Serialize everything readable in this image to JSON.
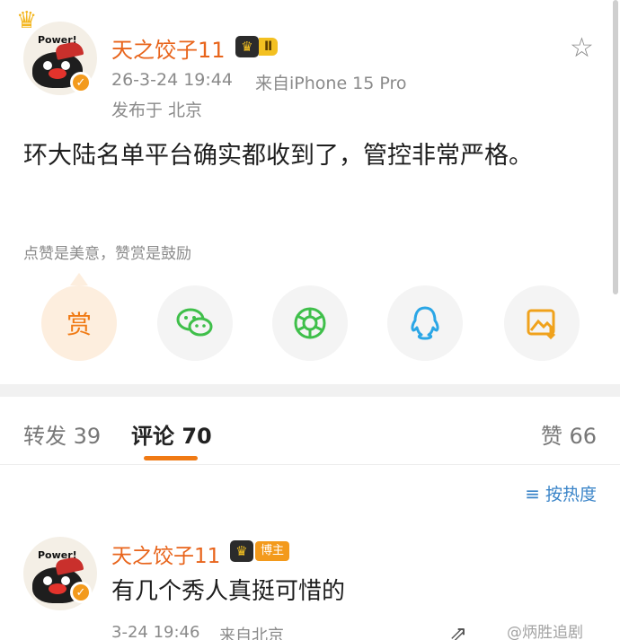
{
  "post": {
    "author": "天之饺子11",
    "level_badge": "Ⅱ",
    "avatar_text": "Power!",
    "timestamp": "26-3-24 19:44",
    "source": "来自iPhone 15 Pro",
    "location": "发布于 北京",
    "content": "环大陆名单平台确实都收到了，管控非常严格。",
    "reward_hint": "点赞是美意，赞赏是鼓励",
    "reward_button": "赏",
    "share_icons": [
      "wechat-icon",
      "moments-icon",
      "qq-icon",
      "save-image-icon"
    ]
  },
  "tabs": {
    "repost_label": "转发",
    "repost_count": "39",
    "comment_label": "评论",
    "comment_count": "70",
    "like_label": "赞",
    "like_count": "66"
  },
  "sort": {
    "label": "按热度"
  },
  "comment": {
    "author": "天之饺子11",
    "avatar_text": "Power!",
    "badge": "博主",
    "text": "有几个秀人真挺可惜的",
    "timestamp": "3-24 19:46",
    "source": "来自北京"
  },
  "watermark": "@炳胜追剧",
  "colors": {
    "accent": "#f07a14",
    "name": "#e8641b",
    "link": "#3a84c8",
    "verified": "#f39a1c"
  }
}
